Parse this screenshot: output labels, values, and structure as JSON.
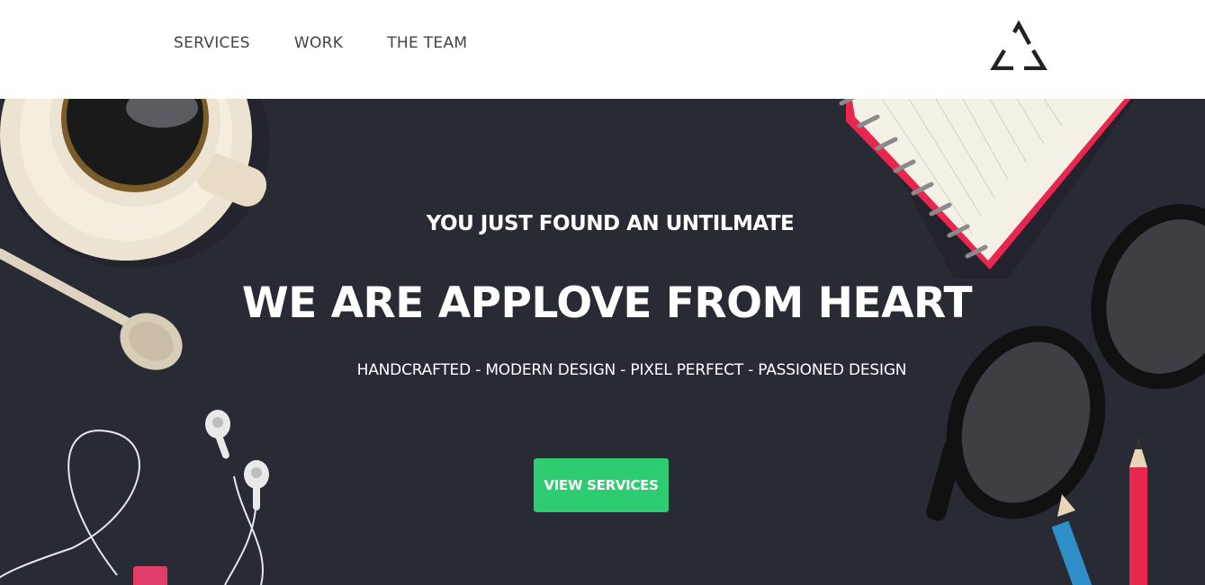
{
  "nav": {
    "items": [
      {
        "label": "SERVICES"
      },
      {
        "label": "WORK"
      },
      {
        "label": "THE TEAM"
      }
    ],
    "logo_icon": "triangle-recycle-logo-icon"
  },
  "hero": {
    "kicker": "YOU JUST FOUND AN UNTILMATE",
    "headline": "WE ARE APPLOVE FROM HEART",
    "tagline": "HANDCRAFTED - MODERN DESIGN - PIXEL PERFECT - PASSIONED DESIGN",
    "cta_label": "VIEW SERVICES",
    "background_color": "#282a34",
    "cta_color": "#2ecc71"
  }
}
